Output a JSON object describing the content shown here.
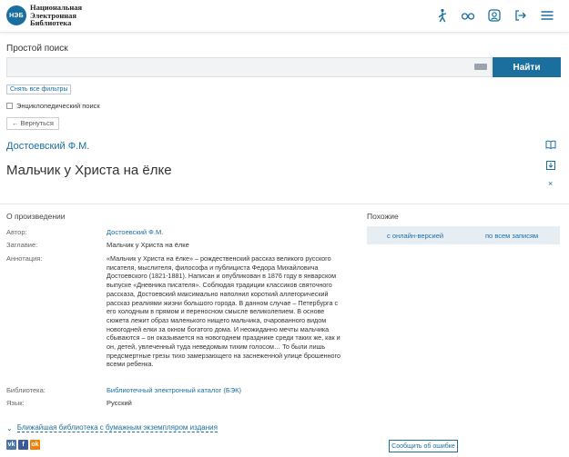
{
  "header": {
    "logo_abbr": "НЭБ",
    "logo_lines": [
      "Национальная",
      "Электронная",
      "Библиотека"
    ]
  },
  "search": {
    "label": "Простой поиск",
    "value": "",
    "placeholder": "",
    "button": "Найти"
  },
  "filters": {
    "reset": "Снять все фильтры",
    "encyclopedic": "Энциклопедический поиск",
    "back": "Вернуться"
  },
  "book": {
    "author": "Достоевский Ф.М.",
    "title": "Мальчик у Христа на ёлке"
  },
  "about": {
    "heading": "О произведении",
    "author_label": "Автор:",
    "author_value": "Достоевский Ф.М.",
    "title_label": "Заглавие:",
    "title_value": "Мальчик у Христа на ёлке",
    "annotation_label": "Аннотация:",
    "annotation_value": "«Мальчик у Христа на ёлке» – рождественский рассказ великого русского писателя, мыслителя, философа и публициста Федора Михайловича Достоевского (1821-1881). Написан и опубликован в 1876 году в январском выпуске «Дневника писателя». Соблюдая традиции классиков святочного рассказа, Достоевский максимально наполнил короткий аллегорический рассказ реалиями жизни большого города. В данном случае – Петербурга с его холодным в прямом и переносном смысле великолепием. В основе сюжета лежит образ маленького нищего мальчика, очарованного видом новогодней елки за окном богатого дома. И неожиданно мечты мальчика сбываются – он оказывается на новогоднем празднике среди таких же, как и он, детей, увлеченный туда неведомым тихим голосом… То были лишь предсмертные грезы тихо замерзающего на заснеженной улице брошенного всеми ребенка.",
    "library_label": "Библиотека:",
    "library_value": "Библиотечный электронный каталог (БЭК)",
    "language_label": "Язык:",
    "language_value": "Русский"
  },
  "similar": {
    "heading": "Похожие",
    "online": "с онлайн-версией",
    "all": "по всем записям"
  },
  "footer": {
    "nearest": "Ближайшая библиотека с бумажным экземпляром издания",
    "report": "Сообщить об ошибке",
    "socials": [
      "vk",
      "f",
      "ok"
    ]
  },
  "colors": {
    "accent": "#1b6f9e",
    "similar_bg": "#e6eef4"
  }
}
